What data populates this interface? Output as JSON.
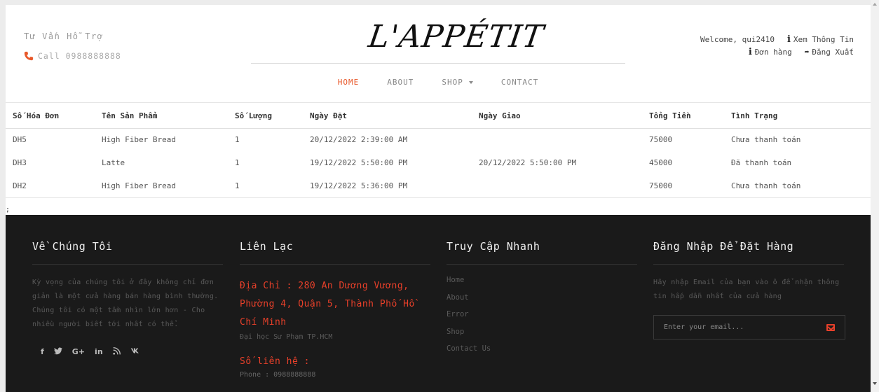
{
  "header": {
    "support_text": "Tư Vấn Hỗ Trợ",
    "call_text": "Call 0988888888",
    "logo": "L'APPÉTIT",
    "nav": [
      {
        "label": "HOME",
        "active": true
      },
      {
        "label": "ABOUT",
        "active": false
      },
      {
        "label": "SHOP",
        "active": false
      },
      {
        "label": "CONTACT",
        "active": false
      }
    ],
    "user": {
      "welcome": "Welcome, qui2410",
      "view_info": "Xem Thông Tin",
      "orders": "Đơn hàng",
      "logout": "Đăng Xuất"
    }
  },
  "orders": {
    "columns": [
      "Số Hóa Đơn",
      "Tên Sản Phẩm",
      "Số Lượng",
      "Ngày Đặt",
      "Ngày Giao",
      "Tổng Tiền",
      "Tình Trạng"
    ],
    "rows": [
      [
        "DH5",
        "High Fiber Bread",
        "1",
        "20/12/2022 2:39:00 AM",
        "",
        "75000",
        "Chưa thanh toán"
      ],
      [
        "DH3",
        "Latte",
        "1",
        "19/12/2022 5:50:00 PM",
        "20/12/2022 5:50:00 PM",
        "45000",
        "Đã thanh toán"
      ],
      [
        "DH2",
        "High Fiber Bread",
        "1",
        "19/12/2022 5:36:00 PM",
        "",
        "75000",
        "Chưa thanh toán"
      ]
    ],
    "stray": ";"
  },
  "footer": {
    "about": {
      "title": "Về Chúng Tôi",
      "text": "Kỳ vọng của chúng tôi ở đây không chỉ đơn giản là một cửa hàng bán hàng bình thường. Chúng tôi có một tầm nhìn lớn hơn - Cho nhiều người biết tới nhất có thể.",
      "social": [
        "f",
        "t",
        "G+",
        "in",
        "rss",
        "vk"
      ]
    },
    "contact": {
      "title": "Liên Lạc",
      "address": "Địa Chỉ : 280 An Dương Vương, Phường 4, Quận 5, Thành Phố Hồ Chí Minh",
      "address_sub": "Đại học Sư Phạm TP.HCM",
      "phone_label": "Số liên hệ :",
      "phone": "Phone : 0988888888"
    },
    "quick": {
      "title": "Truy Cập Nhanh",
      "links": [
        "Home",
        "About",
        "Error",
        "Shop",
        "Contact Us"
      ]
    },
    "login": {
      "title": "Đăng Nhập Để Đặt Hàng",
      "text": "Hãy nhập Email của bạn vào ô để nhận thông tin hấp dẫn nhất của cửa hàng",
      "email_placeholder": "Enter your email..."
    }
  },
  "colors": {
    "accent": "#e8592b",
    "footer_bg": "#1a1a1a",
    "footer_accent": "#e8402a"
  }
}
